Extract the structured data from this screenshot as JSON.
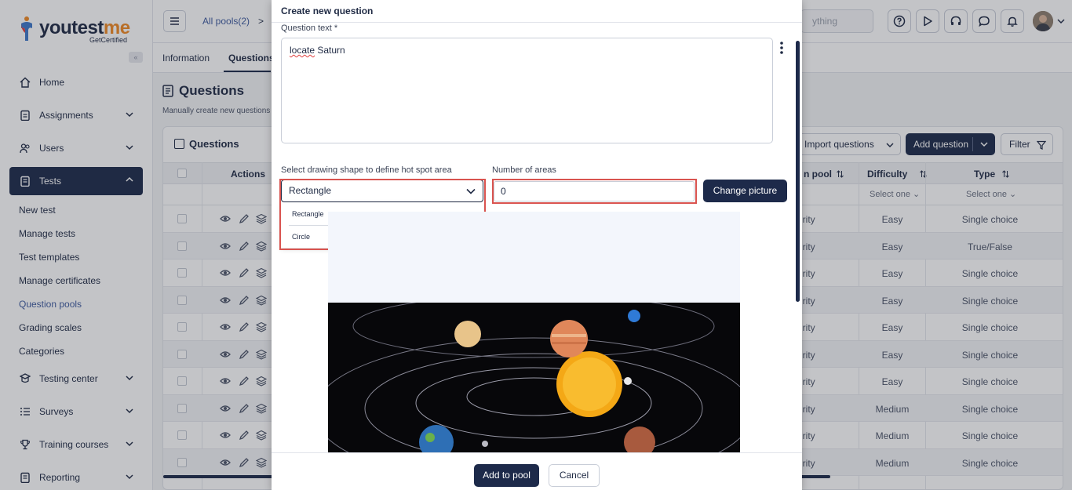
{
  "logo": {
    "brand_a": "you",
    "brand_b": "test",
    "brand_c": "me",
    "tagline": "GetCertified"
  },
  "sidebar": {
    "items": [
      {
        "label": "Home"
      },
      {
        "label": "Assignments"
      },
      {
        "label": "Users"
      },
      {
        "label": "Tests"
      },
      {
        "label": "Testing center"
      },
      {
        "label": "Surveys"
      },
      {
        "label": "Training courses"
      },
      {
        "label": "Reporting"
      }
    ],
    "tests_sub": [
      "New test",
      "Manage tests",
      "Test templates",
      "Manage certificates",
      "Question pools",
      "Grading scales",
      "Categories"
    ],
    "collapse_glyph": "«"
  },
  "topbar": {
    "breadcrumb": "All pools(2)",
    "separator": ">",
    "search_placeholder": "ything"
  },
  "tabs": [
    "Information",
    "Questions"
  ],
  "page": {
    "title": "Questions",
    "description": "Manually create new questions o"
  },
  "card": {
    "title": "Questions",
    "import_label": "Import questions",
    "add_label": "Add question",
    "filter_label": "Filter",
    "columns": {
      "actions": "Actions",
      "pool": "n pool",
      "difficulty": "Difficulty",
      "type": "Type"
    },
    "filter_placeholder": "Select one",
    "pool_filter_partial": "h",
    "rows": [
      {
        "pool": "urity",
        "difficulty": "Easy",
        "type": "Single choice"
      },
      {
        "pool": "urity",
        "difficulty": "Easy",
        "type": "True/False"
      },
      {
        "pool": "urity",
        "difficulty": "Easy",
        "type": "Single choice"
      },
      {
        "pool": "urity",
        "difficulty": "Easy",
        "type": "Single choice"
      },
      {
        "pool": "urity",
        "difficulty": "Easy",
        "type": "Single choice"
      },
      {
        "pool": "urity",
        "difficulty": "Easy",
        "type": "Single choice"
      },
      {
        "pool": "urity",
        "difficulty": "Easy",
        "type": "Single choice"
      },
      {
        "pool": "urity",
        "difficulty": "Medium",
        "type": "Single choice"
      },
      {
        "pool": "urity",
        "difficulty": "Medium",
        "type": "Single choice"
      },
      {
        "pool": "urity",
        "difficulty": "Medium",
        "type": "Single choice"
      }
    ]
  },
  "modal": {
    "title": "Create new question",
    "question_label": "Question text *",
    "question_word1": "locate",
    "question_word2": "Saturn",
    "shape_label": "Select drawing shape to define hot spot area",
    "shape_value": "Rectangle",
    "shape_options": [
      "Rectangle",
      "Circle"
    ],
    "areas_label": "Number of areas",
    "areas_value": "0",
    "change_picture": "Change picture",
    "add_to_pool": "Add to pool",
    "cancel": "Cancel"
  },
  "colors": {
    "primary": "#1d2a4a",
    "accent": "#f08a24",
    "highlight": "#d9534f",
    "link": "#3d5a9e"
  }
}
